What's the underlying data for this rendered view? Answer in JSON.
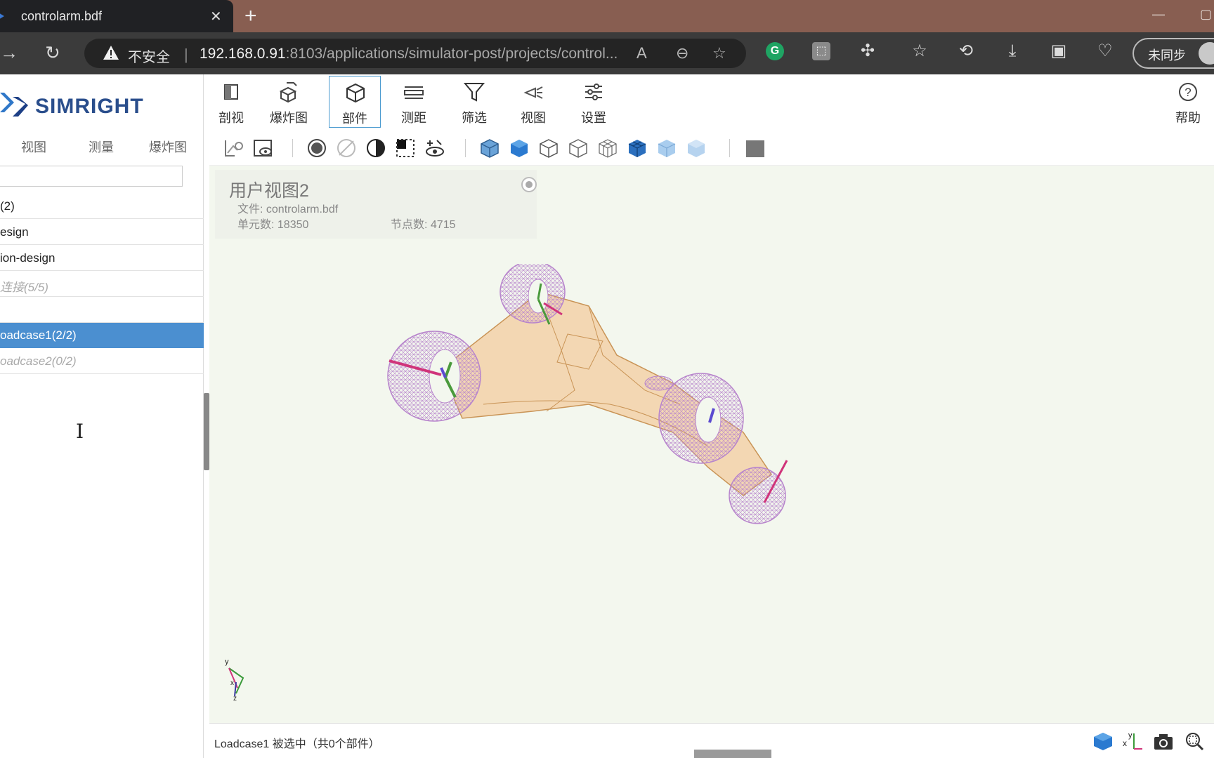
{
  "browser": {
    "tab_title": "controlarm.bdf",
    "tab_close": "✕",
    "new_tab": "+",
    "insecure_label": "不安全",
    "url_host": "192.168.0.91",
    "url_rest": ":8103/applications/simulator-post/projects/control...",
    "profile_label": "未同步"
  },
  "app": {
    "logo_text": "SIMRIGHT",
    "left_tabs": [
      "视图",
      "测量",
      "爆炸图"
    ],
    "tree_rows": [
      {
        "label": "(2)"
      },
      {
        "label": "esign"
      },
      {
        "label": "ion-design"
      },
      {
        "label": "连接(5/5)"
      },
      {
        "label": ""
      },
      {
        "label": "oadcase1(2/2)"
      },
      {
        "label": "oadcase2(0/2)"
      }
    ],
    "toolbar": {
      "section": "剖视",
      "explode": "爆炸图",
      "part": "部件",
      "measure": "测距",
      "filter": "筛选",
      "view": "视图",
      "settings": "设置",
      "help": "帮助"
    },
    "info": {
      "title": "用户视图2",
      "file": "文件: controlarm.bdf",
      "elements": "单元数: 18350",
      "nodes": "节点数: 4715"
    },
    "status_text": "Loadcase1 被选中（共0个部件）",
    "accent_color": "#4b8fd0",
    "mesh_color": "#b784cc",
    "body_color": "#f2c99a"
  }
}
